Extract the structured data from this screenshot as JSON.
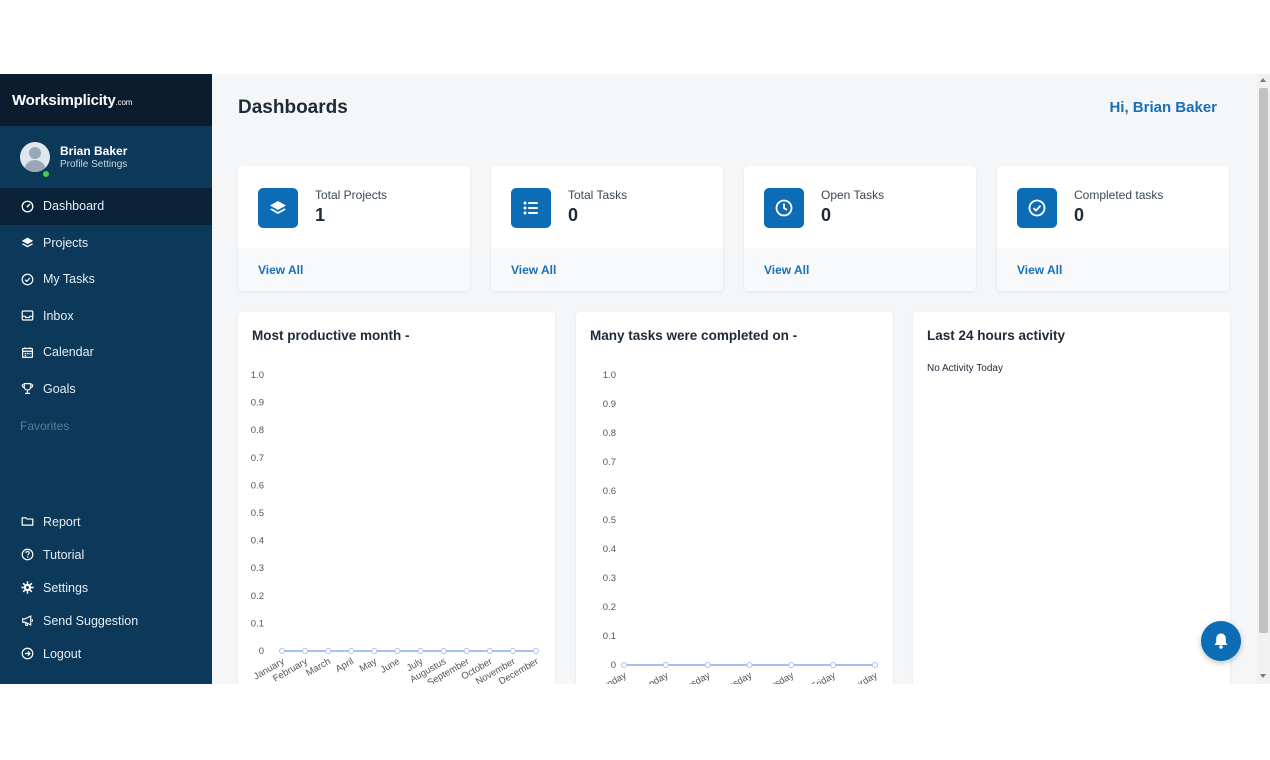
{
  "brand": {
    "name": "Worksimplicity",
    "suffix": ".com"
  },
  "profile": {
    "name": "Brian Baker",
    "subtitle": "Profile Settings"
  },
  "nav": {
    "items": [
      {
        "label": "Dashboard",
        "icon": "dashboard-icon",
        "active": true
      },
      {
        "label": "Projects",
        "icon": "layers-icon"
      },
      {
        "label": "My Tasks",
        "icon": "check-circle-icon"
      },
      {
        "label": "Inbox",
        "icon": "inbox-icon"
      },
      {
        "label": "Calendar",
        "icon": "calendar-icon"
      },
      {
        "label": "Goals",
        "icon": "trophy-icon"
      }
    ],
    "favorites_label": "Favorites",
    "bottom_items": [
      {
        "label": "Report",
        "icon": "folder-icon"
      },
      {
        "label": "Tutorial",
        "icon": "question-icon"
      },
      {
        "label": "Settings",
        "icon": "gear-icon"
      },
      {
        "label": "Send Suggestion",
        "icon": "megaphone-icon"
      },
      {
        "label": "Logout",
        "icon": "logout-icon"
      }
    ]
  },
  "header": {
    "title": "Dashboards",
    "greeting": "Hi, Brian Baker"
  },
  "cards": [
    {
      "label": "Total Projects",
      "value": "1",
      "link": "View All",
      "icon": "layers-icon"
    },
    {
      "label": "Total Tasks",
      "value": "0",
      "link": "View All",
      "icon": "list-icon"
    },
    {
      "label": "Open Tasks",
      "value": "0",
      "link": "View All",
      "icon": "clock-icon"
    },
    {
      "label": "Completed tasks",
      "value": "0",
      "link": "View All",
      "icon": "check-circle-icon"
    }
  ],
  "panels": {
    "month_title": "Most productive month -",
    "weekday_title": "Many tasks were completed on -",
    "activity_title": "Last 24 hours activity",
    "activity_empty": "No Activity Today"
  },
  "colors": {
    "sidebar": "#0c3859",
    "accent": "#0c6cb5",
    "link": "#1a6fb5",
    "line": "#a8c0f0"
  },
  "chart_data": [
    {
      "type": "line",
      "title": "Most productive month -",
      "categories": [
        "January",
        "February",
        "March",
        "April",
        "May",
        "June",
        "July",
        "Augustus",
        "September",
        "October",
        "November",
        "December"
      ],
      "values": [
        0,
        0,
        0,
        0,
        0,
        0,
        0,
        0,
        0,
        0,
        0,
        0
      ],
      "ylim": [
        0,
        1
      ],
      "yticks": [
        "0",
        "0.1",
        "0.2",
        "0.3",
        "0.4",
        "0.5",
        "0.6",
        "0.7",
        "0.8",
        "0.9",
        "1.0"
      ]
    },
    {
      "type": "line",
      "title": "Many tasks were completed on -",
      "categories": [
        "Sunday",
        "Monday",
        "Tuesday",
        "Wednesday",
        "Thursday",
        "Friday",
        "Saturday"
      ],
      "values": [
        0,
        0,
        0,
        0,
        0,
        0,
        0
      ],
      "ylim": [
        0,
        1
      ],
      "yticks": [
        "0",
        "0.1",
        "0.2",
        "0.3",
        "0.4",
        "0.5",
        "0.6",
        "0.7",
        "0.8",
        "0.9",
        "1.0"
      ]
    }
  ]
}
